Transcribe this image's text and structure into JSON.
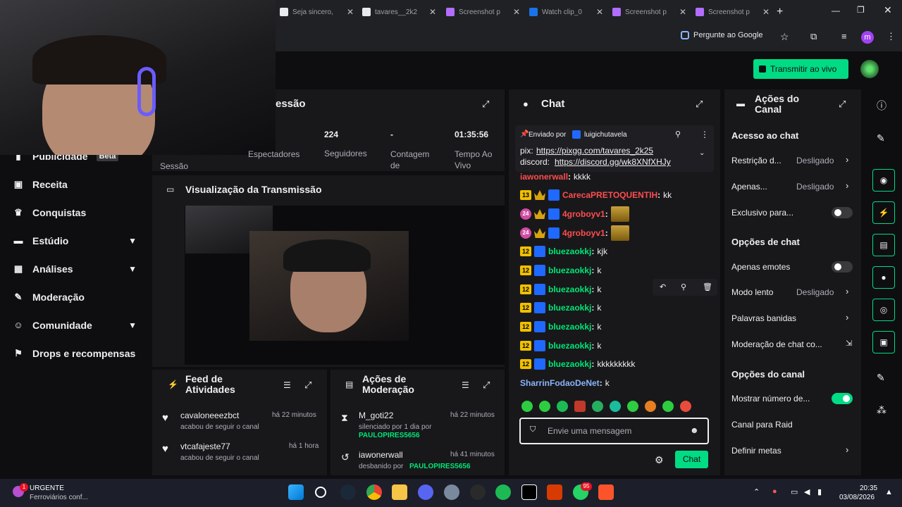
{
  "browser": {
    "tabs": [
      {
        "label": "Seja sincero,",
        "color": "#e8eaed"
      },
      {
        "label": "tavares__2k2",
        "color": "#e8eaed"
      },
      {
        "label": "Screenshot p",
        "color": "#b36dff"
      },
      {
        "label": "Watch clip_0",
        "color": "#1a73e8"
      },
      {
        "label": "Screenshot p",
        "color": "#b36dff"
      },
      {
        "label": "Screenshot p",
        "color": "#b36dff"
      }
    ],
    "ask_google": "Pergunte ao Google",
    "profile_initial": "m"
  },
  "header": {
    "go_live": "Transmitir ao vivo"
  },
  "sidebar": {
    "items": [
      {
        "label": "Publicidade",
        "badge": "Beta"
      },
      {
        "label": "Receita"
      },
      {
        "label": "Conquistas"
      },
      {
        "label": "Estúdio"
      },
      {
        "label": "Análises"
      },
      {
        "label": "Moderação"
      },
      {
        "label": "Comunidade"
      },
      {
        "label": "Drops e recompensas"
      }
    ]
  },
  "session": {
    "title": "essão",
    "stats": [
      {
        "value": "",
        "label": "Sessão"
      },
      {
        "value": "",
        "label": "Espectadores"
      },
      {
        "value": "224",
        "label": "Seguidores"
      },
      {
        "value": "-",
        "label": "Contagem de"
      },
      {
        "value": "01:35:56",
        "label": "Tempo Ao Vivo"
      }
    ]
  },
  "preview": {
    "title": "Visualização da Transmissão"
  },
  "activity": {
    "title": "Feed de Atividades",
    "items": [
      {
        "user": "cavaloneeezbct",
        "time": "há 22 minutos",
        "desc": "acabou de seguir o canal"
      },
      {
        "user": "vtcafajeste77",
        "time": "há 1 hora",
        "desc": "acabou de seguir o canal"
      }
    ]
  },
  "modactions": {
    "title": "Ações de Moderação",
    "items": [
      {
        "user": "M_goti22",
        "time": "há 22 minutos",
        "desc": "silenciado por 1 dia por",
        "by": "PAULOPIRES5656"
      },
      {
        "user": "iawonerwall",
        "time": "há 41 minutos",
        "desc": "desbanido por",
        "by": "PAULOPIRES5656"
      }
    ]
  },
  "chat": {
    "title": "Chat",
    "pinned": {
      "sent_by": "Enviado por",
      "sender": "luigichutavela",
      "line1_label": "pix:",
      "line1_link": "https://pixgg.com/tavares_2k25",
      "line2_label": "discord:",
      "line2_link": "https://discord.gg/wk8XNfXHJy"
    },
    "messages": [
      {
        "badge": "",
        "user": "iawonerwall",
        "color": "#ff4d4d",
        "text": "kkkk"
      },
      {
        "badge": "13",
        "user": "CarecaPRETOQUENTIH",
        "color": "#ff4d4d",
        "text": "kk"
      },
      {
        "badge": "24",
        "user": "4groboyv1",
        "color": "#ff4d4d",
        "text": ""
      },
      {
        "badge": "24",
        "user": "4groboyv1",
        "color": "#ff4d4d",
        "text": ""
      },
      {
        "badge": "12",
        "user": "bluezaokkj",
        "color": "#00e676",
        "text": "kjk"
      },
      {
        "badge": "12",
        "user": "bluezaokkj",
        "color": "#00e676",
        "text": "k"
      },
      {
        "badge": "12",
        "user": "bluezaokkj",
        "color": "#00e676",
        "text": "k"
      },
      {
        "badge": "12",
        "user": "bluezaokkj",
        "color": "#00e676",
        "text": "k"
      },
      {
        "badge": "12",
        "user": "bluezaokkj",
        "color": "#00e676",
        "text": "k"
      },
      {
        "badge": "12",
        "user": "bluezaokkj",
        "color": "#00e676",
        "text": "k"
      },
      {
        "badge": "12",
        "user": "bluezaokkj",
        "color": "#00e676",
        "text": "kkkkkkkkk"
      },
      {
        "badge": "",
        "user": "SharrinFodaoDeNet",
        "color": "#8ab4f8",
        "text": "k"
      }
    ],
    "input_placeholder": "Envie uma mensagem",
    "send_label": "Chat"
  },
  "channel_actions": {
    "title": "Ações do Canal",
    "sections": {
      "chat_access": "Acesso ao chat",
      "chat_options": "Opções de chat",
      "channel_options": "Opções do canal"
    },
    "rows": {
      "restriction": {
        "label": "Restrição d...",
        "value": "Desligado"
      },
      "only": {
        "label": "Apenas...",
        "value": "Desligado"
      },
      "exclusive": {
        "label": "Exclusivo para...",
        "on": false
      },
      "emotes_only": {
        "label": "Apenas emotes",
        "on": false
      },
      "slow": {
        "label": "Modo lento",
        "value": "Desligado"
      },
      "banned_words": {
        "label": "Palavras banidas"
      },
      "chat_mod": {
        "label": "Moderação de chat co..."
      },
      "show_count": {
        "label": "Mostrar número de...",
        "on": true
      },
      "raid": {
        "label": "Canal para Raid"
      },
      "goals": {
        "label": "Definir metas"
      }
    }
  },
  "taskbar": {
    "notification_title": "URGENTE",
    "notification_sub": "Ferroviários conf...",
    "notification_count": "1",
    "time": "20:35",
    "date": "03/08/2026",
    "whatsapp_count": "95"
  }
}
